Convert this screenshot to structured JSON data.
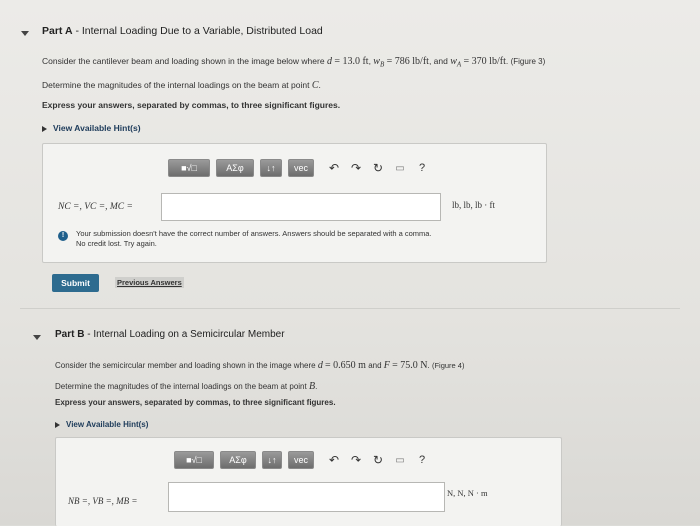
{
  "partA": {
    "label": "Part A",
    "title": "- Internal Loading Due to a Variable, Distributed Load",
    "statement_prefix": "Consider the cantilever beam and loading shown in the image below where",
    "d_var": "d",
    "d_val": "= 13.0 ft",
    "wB_var": "w",
    "wB_sub": "B",
    "wB_val": "= 786 lb/ft",
    "and": ", and",
    "wA_var": "w",
    "wA_sub": "A",
    "wA_val": "= 370 lb/ft",
    "figure": "(Figure 3)",
    "determine": "Determine the magnitudes of the internal loadings on the beam at point",
    "point": "C",
    "instruction": "Express your answers, separated by commas, to three significant figures.",
    "hint": "View Available Hint(s)",
    "lhs": "N",
    "lhs_full": "NC =, VC =, MC =",
    "units": "lb, lb, lb · ft",
    "feedback_line1": "Your submission doesn't have the correct number of answers. Answers should be separated with a comma.",
    "feedback_line2": "No credit lost. Try again.",
    "submit": "Submit",
    "previous": "Previous Answers"
  },
  "partB": {
    "label": "Part B",
    "title": "- Internal Loading on a Semicircular Member",
    "statement_prefix": "Consider the semicircular member and loading shown in the image where",
    "d_var": "d",
    "d_val": "= 0.650 m",
    "and": "and",
    "F_var": "F",
    "F_val": "= 75.0 N",
    "figure": "(Figure 4)",
    "determine": "Determine the magnitudes of the internal loadings on the beam at point",
    "point": "B",
    "instruction": "Express your answers, separated by commas, to three significant figures.",
    "hint": "View Available Hint(s)",
    "lhs_full": "NB =, VB =, MB =",
    "units": "N, N, N · m"
  },
  "toolbar": {
    "templates": "■√□",
    "greek": "ΑΣφ",
    "arrows": "↓↑",
    "vec": "vec",
    "undo": "↶",
    "redo": "↷",
    "reset": "↻",
    "keyboard": "▭",
    "help": "?"
  }
}
